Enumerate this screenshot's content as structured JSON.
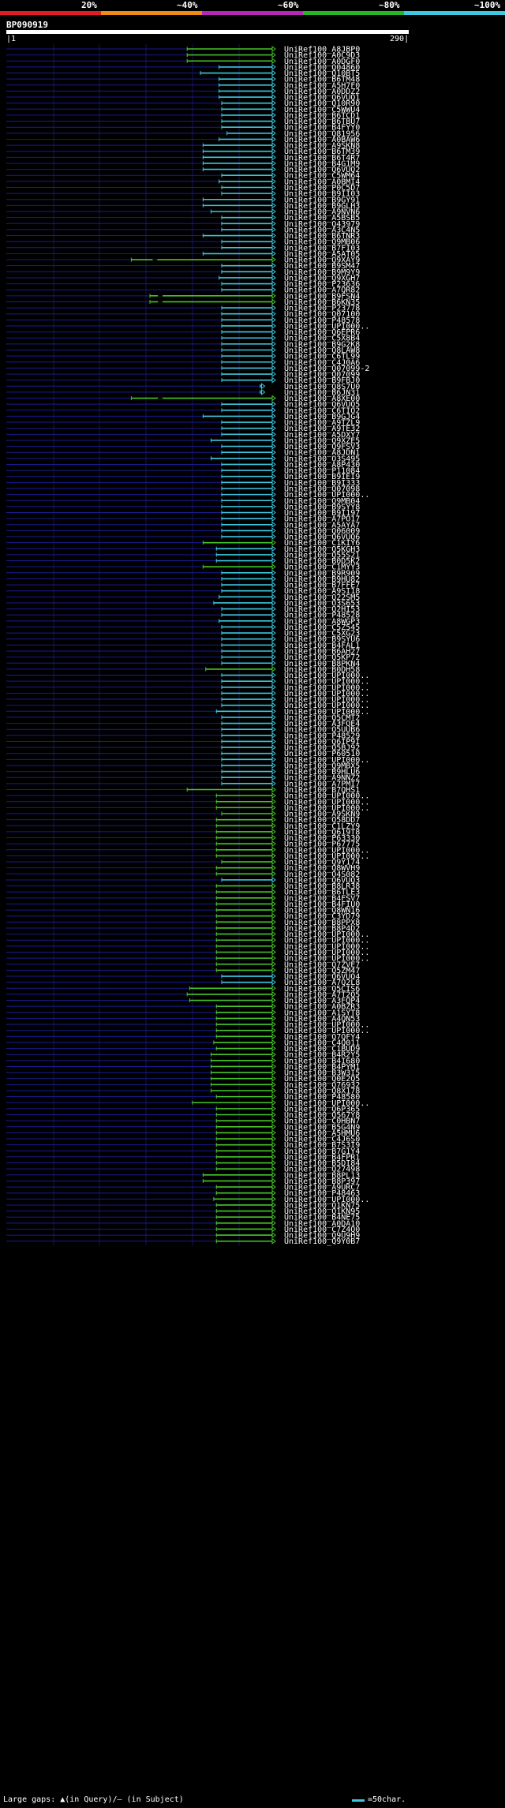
{
  "header": {
    "legend": [
      {
        "label": "20%",
        "color": "#e01c24"
      },
      {
        "label": "~40%",
        "color": "#f08c14"
      },
      {
        "label": "~60%",
        "color": "#b428b4"
      },
      {
        "label": "~80%",
        "color": "#28b428"
      },
      {
        "label": "~100%",
        "color": "#3cc8e0"
      }
    ],
    "query_name": "BP090919",
    "ruler_start": "1",
    "ruler_end": "290"
  },
  "footer": {
    "gaps_text": "Large gaps: ▲(in Query)/– (in Subject)",
    "scale_text": "=50char."
  },
  "colors": {
    "cyan": "#3cc8e0",
    "green": "#46c828",
    "blue": "#1a1a96",
    "grid": "#141450"
  },
  "hits": [
    {
      "id": "UniRef100_A8JBP0",
      "start": 0.68,
      "color": "green"
    },
    {
      "id": "UniRef100_A0C9D3",
      "start": 0.68,
      "color": "green"
    },
    {
      "id": "UniRef100_A0DGF0",
      "start": 0.68,
      "color": "green"
    },
    {
      "id": "UniRef100_Q04860",
      "start": 0.8,
      "color": "cyan"
    },
    {
      "id": "UniRef100_Q10BT5",
      "start": 0.73,
      "color": "cyan"
    },
    {
      "id": "UniRef100_B6TM48",
      "start": 0.8,
      "color": "cyan"
    },
    {
      "id": "UniRef100_A5H7F0",
      "start": 0.8,
      "color": "cyan"
    },
    {
      "id": "UniRef100_A0DDZ2",
      "start": 0.8,
      "color": "cyan"
    },
    {
      "id": "UniRef100_Q6VUQ1",
      "start": 0.8,
      "color": "cyan"
    },
    {
      "id": "UniRef100_Q10R90",
      "start": 0.81,
      "color": "cyan"
    },
    {
      "id": "UniRef100_C5WWU4",
      "start": 0.81,
      "color": "cyan"
    },
    {
      "id": "UniRef100_B6TCD1",
      "start": 0.81,
      "color": "cyan"
    },
    {
      "id": "UniRef100_B6TBU7",
      "start": 0.81,
      "color": "cyan"
    },
    {
      "id": "UniRef100_B4FYY0",
      "start": 0.81,
      "color": "cyan"
    },
    {
      "id": "UniRef100_Q81956",
      "start": 0.83,
      "color": "cyan"
    },
    {
      "id": "UniRef100_A0BAW6",
      "start": 0.8,
      "color": "cyan"
    },
    {
      "id": "UniRef100_A9SKN8",
      "start": 0.74,
      "color": "cyan"
    },
    {
      "id": "UniRef100_B6TM39",
      "start": 0.74,
      "color": "cyan"
    },
    {
      "id": "UniRef100_B6T4R7",
      "start": 0.74,
      "color": "cyan"
    },
    {
      "id": "UniRef100_B4G1M9",
      "start": 0.74,
      "color": "cyan"
    },
    {
      "id": "UniRef100_Q6VUQ2",
      "start": 0.74,
      "color": "cyan"
    },
    {
      "id": "UniRef100_C5WM64",
      "start": 0.81,
      "color": "cyan"
    },
    {
      "id": "UniRef100_A0BMI4",
      "start": 0.8,
      "color": "cyan"
    },
    {
      "id": "UniRef100_P0C5D7",
      "start": 0.81,
      "color": "cyan"
    },
    {
      "id": "UniRef100_B9II03",
      "start": 0.81,
      "color": "cyan"
    },
    {
      "id": "UniRef100_B9GY91",
      "start": 0.74,
      "color": "cyan"
    },
    {
      "id": "UniRef100_B9GLH3",
      "start": 0.74,
      "color": "cyan"
    },
    {
      "id": "UniRef100_A9NVN6",
      "start": 0.77,
      "color": "cyan"
    },
    {
      "id": "UniRef100_A5BSB5",
      "start": 0.81,
      "color": "cyan"
    },
    {
      "id": "UniRef100_Q43979",
      "start": 0.81,
      "color": "cyan"
    },
    {
      "id": "UniRef100_A3C4N5",
      "start": 0.81,
      "color": "cyan"
    },
    {
      "id": "UniRef100_B6TNR3",
      "start": 0.74,
      "color": "cyan"
    },
    {
      "id": "UniRef100_Q9MB06",
      "start": 0.81,
      "color": "cyan"
    },
    {
      "id": "UniRef100_B7FI03",
      "start": 0.81,
      "color": "cyan"
    },
    {
      "id": "UniRef100_A5AT05",
      "start": 0.74,
      "color": "cyan"
    },
    {
      "id": "UniRef100_Q9XAY9",
      "start": 0.47,
      "color": "green",
      "gap": 0.55
    },
    {
      "id": "UniRef100_B9SM47",
      "start": 0.81,
      "color": "cyan"
    },
    {
      "id": "UniRef100_B9M9Y9",
      "start": 0.81,
      "color": "cyan"
    },
    {
      "id": "UniRef100_Q9XGH7",
      "start": 0.8,
      "color": "cyan"
    },
    {
      "id": "UniRef100_P23636",
      "start": 0.81,
      "color": "cyan"
    },
    {
      "id": "UniRef100_A7QR82",
      "start": 0.81,
      "color": "cyan"
    },
    {
      "id": "UniRef100_B9FSN4",
      "start": 0.54,
      "color": "green",
      "gap": 0.57
    },
    {
      "id": "UniRef100_B6KN35",
      "start": 0.54,
      "color": "green",
      "gap": 0.57
    },
    {
      "id": "UniRef100_P23778",
      "start": 0.81,
      "color": "cyan"
    },
    {
      "id": "UniRef100_Q07100",
      "start": 0.81,
      "color": "cyan"
    },
    {
      "id": "UniRef100_P48578",
      "start": 0.81,
      "color": "cyan"
    },
    {
      "id": "UniRef100_UPI000..",
      "start": 0.81,
      "color": "cyan"
    },
    {
      "id": "UniRef100_Q6EPR6",
      "start": 0.81,
      "color": "cyan"
    },
    {
      "id": "UniRef100_C5X8B4",
      "start": 0.81,
      "color": "cyan"
    },
    {
      "id": "UniRef100_B9G2K8",
      "start": 0.81,
      "color": "cyan"
    },
    {
      "id": "UniRef100_Q8LAW8",
      "start": 0.81,
      "color": "cyan"
    },
    {
      "id": "UniRef100_C6TL99",
      "start": 0.81,
      "color": "cyan"
    },
    {
      "id": "UniRef100_C4J0A6",
      "start": 0.81,
      "color": "cyan"
    },
    {
      "id": "UniRef100_Q07099-2",
      "start": 0.81,
      "color": "cyan"
    },
    {
      "id": "UniRef100_Q07099",
      "start": 0.81,
      "color": "cyan"
    },
    {
      "id": "UniRef100_B9FBJ0",
      "start": 0.81,
      "color": "cyan"
    },
    {
      "id": "UniRef100_Q8S7U0",
      "start": 0.955,
      "color": "cyan",
      "end": 0.96
    },
    {
      "id": "UniRef100_B6JN31",
      "start": 0.955,
      "color": "cyan",
      "end": 0.96
    },
    {
      "id": "UniRef100_A8XE00",
      "start": 0.47,
      "color": "green",
      "gap": 0.57
    },
    {
      "id": "UniRef100_Q6VUQ5",
      "start": 0.81,
      "color": "cyan"
    },
    {
      "id": "UniRef100_C6TIO2",
      "start": 0.81,
      "color": "cyan"
    },
    {
      "id": "UniRef100_B9GJG4",
      "start": 0.74,
      "color": "cyan"
    },
    {
      "id": "UniRef100_A9TZL9",
      "start": 0.81,
      "color": "cyan"
    },
    {
      "id": "UniRef100_A9TE32",
      "start": 0.81,
      "color": "cyan"
    },
    {
      "id": "UniRef100_A5DXY7",
      "start": 0.81,
      "color": "cyan"
    },
    {
      "id": "UniRef100_Q9XZE5",
      "start": 0.77,
      "color": "cyan"
    },
    {
      "id": "UniRef100_Q9FSV3",
      "start": 0.81,
      "color": "cyan"
    },
    {
      "id": "UniRef100_A8JDN1",
      "start": 0.81,
      "color": "cyan"
    },
    {
      "id": "UniRef100_O3S495",
      "start": 0.77,
      "color": "cyan"
    },
    {
      "id": "UniRef100_A8P430",
      "start": 0.81,
      "color": "cyan"
    },
    {
      "id": "UniRef100_P11084",
      "start": 0.81,
      "color": "cyan"
    },
    {
      "id": "UniRef100_B9IEI9",
      "start": 0.81,
      "color": "cyan"
    },
    {
      "id": "UniRef100_B9I333",
      "start": 0.81,
      "color": "cyan"
    },
    {
      "id": "UniRef100_Q07098",
      "start": 0.81,
      "color": "cyan"
    },
    {
      "id": "UniRef100_UPI000..",
      "start": 0.81,
      "color": "cyan"
    },
    {
      "id": "UniRef100_Q9MB04",
      "start": 0.81,
      "color": "cyan"
    },
    {
      "id": "UniRef100_B9SYY8",
      "start": 0.81,
      "color": "cyan"
    },
    {
      "id": "UniRef100_B9I197",
      "start": 0.81,
      "color": "cyan"
    },
    {
      "id": "UniRef100_A7PO17",
      "start": 0.81,
      "color": "cyan"
    },
    {
      "id": "UniRef100_A5AYA7",
      "start": 0.81,
      "color": "cyan"
    },
    {
      "id": "UniRef100_Q06009",
      "start": 0.81,
      "color": "cyan"
    },
    {
      "id": "UniRef100_Q6VUQ6",
      "start": 0.81,
      "color": "cyan"
    },
    {
      "id": "UniRef100_C1KIY6",
      "start": 0.74,
      "color": "green"
    },
    {
      "id": "UniRef100_Q5KGH3",
      "start": 0.79,
      "color": "cyan"
    },
    {
      "id": "UniRef100_Q55S21",
      "start": 0.79,
      "color": "cyan"
    },
    {
      "id": "UniRef100_B0D5K2",
      "start": 0.79,
      "color": "cyan"
    },
    {
      "id": "UniRef100_C1MYY3",
      "start": 0.74,
      "color": "green"
    },
    {
      "id": "UniRef100_B9R909",
      "start": 0.81,
      "color": "cyan"
    },
    {
      "id": "UniRef100_B9HU82",
      "start": 0.81,
      "color": "cyan"
    },
    {
      "id": "UniRef100_B7FFE7",
      "start": 0.81,
      "color": "cyan"
    },
    {
      "id": "UniRef100_A9SI18",
      "start": 0.81,
      "color": "cyan"
    },
    {
      "id": "UniRef100_Q22SM5",
      "start": 0.8,
      "color": "cyan"
    },
    {
      "id": "UniRef100_O3S653",
      "start": 0.78,
      "color": "cyan"
    },
    {
      "id": "UniRef100_Q2HI53",
      "start": 0.81,
      "color": "cyan"
    },
    {
      "id": "UniRef100_P48528",
      "start": 0.81,
      "color": "cyan"
    },
    {
      "id": "UniRef100_A8WGP3",
      "start": 0.8,
      "color": "cyan"
    },
    {
      "id": "UniRef100_C5Z545",
      "start": 0.81,
      "color": "cyan"
    },
    {
      "id": "UniRef100_C5XG23",
      "start": 0.81,
      "color": "cyan"
    },
    {
      "id": "UniRef100_B9SYU6",
      "start": 0.81,
      "color": "cyan"
    },
    {
      "id": "UniRef100_B4FAL1",
      "start": 0.81,
      "color": "cyan"
    },
    {
      "id": "UniRef100_B6AH27",
      "start": 0.81,
      "color": "cyan"
    },
    {
      "id": "UniRef100_Q5KP72",
      "start": 0.81,
      "color": "cyan"
    },
    {
      "id": "UniRef100_B8PKN4",
      "start": 0.81,
      "color": "cyan"
    },
    {
      "id": "UniRef100_B0DH58",
      "start": 0.75,
      "color": "green"
    },
    {
      "id": "UniRef100_UPI000..",
      "start": 0.81,
      "color": "cyan"
    },
    {
      "id": "UniRef100_UPI000..",
      "start": 0.81,
      "color": "cyan"
    },
    {
      "id": "UniRef100_UPI000..",
      "start": 0.81,
      "color": "cyan"
    },
    {
      "id": "UniRef100_UPI000..",
      "start": 0.81,
      "color": "cyan"
    },
    {
      "id": "UniRef100_UPI000..",
      "start": 0.81,
      "color": "cyan"
    },
    {
      "id": "UniRef100_UPI000..",
      "start": 0.81,
      "color": "cyan"
    },
    {
      "id": "UniRef100_UPI000..",
      "start": 0.79,
      "color": "cyan"
    },
    {
      "id": "UniRef100_Q5CMT2",
      "start": 0.81,
      "color": "cyan"
    },
    {
      "id": "UniRef100_A3FQE4",
      "start": 0.81,
      "color": "cyan"
    },
    {
      "id": "UniRef100_Q5UUB6",
      "start": 0.81,
      "color": "cyan"
    },
    {
      "id": "UniRef100_P48529",
      "start": 0.81,
      "color": "cyan"
    },
    {
      "id": "UniRef100_Q6IP9I",
      "start": 0.81,
      "color": "cyan"
    },
    {
      "id": "UniRef100_Q5BJ92",
      "start": 0.81,
      "color": "cyan"
    },
    {
      "id": "UniRef100_P60510",
      "start": 0.81,
      "color": "cyan"
    },
    {
      "id": "UniRef100_UPI000..",
      "start": 0.81,
      "color": "cyan"
    },
    {
      "id": "UniRef100_Q9MBX5",
      "start": 0.81,
      "color": "cyan"
    },
    {
      "id": "UniRef100_B9HLU6",
      "start": 0.81,
      "color": "cyan"
    },
    {
      "id": "UniRef100_A9NNZ2",
      "start": 0.81,
      "color": "cyan"
    },
    {
      "id": "UniRef100_A7PMI7",
      "start": 0.81,
      "color": "cyan"
    },
    {
      "id": "UniRef100_B7QHS1",
      "start": 0.68,
      "color": "green"
    },
    {
      "id": "UniRef100_UPI000..",
      "start": 0.79,
      "color": "green"
    },
    {
      "id": "UniRef100_UPI000..",
      "start": 0.79,
      "color": "green"
    },
    {
      "id": "UniRef100_UPI000..",
      "start": 0.79,
      "color": "green"
    },
    {
      "id": "UniRef100_A9SKN9",
      "start": 0.81,
      "color": "green"
    },
    {
      "id": "UniRef100_Q58DD7",
      "start": 0.79,
      "color": "green"
    },
    {
      "id": "UniRef100_C1LZY9",
      "start": 0.79,
      "color": "green"
    },
    {
      "id": "UniRef100_Q619T8",
      "start": 0.79,
      "color": "green"
    },
    {
      "id": "UniRef100_P63330",
      "start": 0.79,
      "color": "green"
    },
    {
      "id": "UniRef100_P67775",
      "start": 0.79,
      "color": "green"
    },
    {
      "id": "UniRef100_UPI000..",
      "start": 0.79,
      "color": "green"
    },
    {
      "id": "UniRef100_UPI000..",
      "start": 0.79,
      "color": "green"
    },
    {
      "id": "UniRef100_Q9Y174",
      "start": 0.81,
      "color": "green"
    },
    {
      "id": "UniRef100_Q8WVH9",
      "start": 0.79,
      "color": "green"
    },
    {
      "id": "UniRef100_O4S082",
      "start": 0.79,
      "color": "green"
    },
    {
      "id": "UniRef100_Q6VUQ3",
      "start": 0.81,
      "color": "cyan"
    },
    {
      "id": "UniRef100_B8LR38",
      "start": 0.79,
      "color": "green"
    },
    {
      "id": "UniRef100_B6TLE3",
      "start": 0.79,
      "color": "green"
    },
    {
      "id": "UniRef100_B4FSV7",
      "start": 0.79,
      "color": "green"
    },
    {
      "id": "UniRef100_B4FIU0",
      "start": 0.79,
      "color": "green"
    },
    {
      "id": "UniRef100_Q8WN16",
      "start": 0.79,
      "color": "green"
    },
    {
      "id": "UniRef100_C3YD79",
      "start": 0.79,
      "color": "green"
    },
    {
      "id": "UniRef100_B8PPX8",
      "start": 0.79,
      "color": "green"
    },
    {
      "id": "UniRef100_B8P4D2",
      "start": 0.79,
      "color": "green"
    },
    {
      "id": "UniRef100_UPI000..",
      "start": 0.79,
      "color": "green"
    },
    {
      "id": "UniRef100_UPI000..",
      "start": 0.79,
      "color": "green"
    },
    {
      "id": "UniRef100_UPI000..",
      "start": 0.79,
      "color": "green"
    },
    {
      "id": "UniRef100_UPI000..",
      "start": 0.79,
      "color": "green"
    },
    {
      "id": "UniRef100_UPI000..",
      "start": 0.79,
      "color": "green"
    },
    {
      "id": "UniRef100_Q7ZVE7",
      "start": 0.79,
      "color": "green"
    },
    {
      "id": "UniRef100_Q5ZM47",
      "start": 0.79,
      "color": "green"
    },
    {
      "id": "UniRef100_Q6VUQ4",
      "start": 0.81,
      "color": "cyan"
    },
    {
      "id": "UniRef100_A7Q2L8",
      "start": 0.81,
      "color": "cyan"
    },
    {
      "id": "UniRef100_Q5CIS6",
      "start": 0.69,
      "color": "green"
    },
    {
      "id": "UniRef100_A7T2Q5",
      "start": 0.68,
      "color": "green"
    },
    {
      "id": "UniRef100_A3FQP4",
      "start": 0.69,
      "color": "green"
    },
    {
      "id": "UniRef100_A0BZR3",
      "start": 0.79,
      "color": "green"
    },
    {
      "id": "UniRef100_A1SYT8",
      "start": 0.79,
      "color": "green"
    },
    {
      "id": "UniRef100_A4QN53",
      "start": 0.79,
      "color": "green"
    },
    {
      "id": "UniRef100_UPI000..",
      "start": 0.79,
      "color": "green"
    },
    {
      "id": "UniRef100_UPI000..",
      "start": 0.79,
      "color": "green"
    },
    {
      "id": "UniRef100_Q7QFY4",
      "start": 0.79,
      "color": "green"
    },
    {
      "id": "UniRef100_C4Q011",
      "start": 0.78,
      "color": "green"
    },
    {
      "id": "UniRef100_C1BUD9",
      "start": 0.79,
      "color": "green"
    },
    {
      "id": "UniRef100_B4R2Y5",
      "start": 0.77,
      "color": "green"
    },
    {
      "id": "UniRef100_B4I680",
      "start": 0.77,
      "color": "green"
    },
    {
      "id": "UniRef100_B4PYM1",
      "start": 0.77,
      "color": "green"
    },
    {
      "id": "UniRef100_B3W3I5",
      "start": 0.77,
      "color": "green"
    },
    {
      "id": "UniRef100_Q0E2Q5",
      "start": 0.77,
      "color": "green"
    },
    {
      "id": "UniRef100_Q76932",
      "start": 0.77,
      "color": "green"
    },
    {
      "id": "UniRef100_Q8X178",
      "start": 0.77,
      "color": "green"
    },
    {
      "id": "UniRef100_P48580",
      "start": 0.79,
      "color": "green"
    },
    {
      "id": "UniRef100_UPI000..",
      "start": 0.7,
      "color": "green"
    },
    {
      "id": "UniRef100_Q6P365",
      "start": 0.79,
      "color": "green"
    },
    {
      "id": "UniRef100_Q567Y8",
      "start": 0.79,
      "color": "green"
    },
    {
      "id": "UniRef100_C0HBN7",
      "start": 0.79,
      "color": "green"
    },
    {
      "id": "UniRef100_B5G4N9",
      "start": 0.79,
      "color": "green"
    },
    {
      "id": "UniRef100_A5HMU6",
      "start": 0.79,
      "color": "green"
    },
    {
      "id": "UniRef100_C4J6S0",
      "start": 0.79,
      "color": "green"
    },
    {
      "id": "UniRef100_B7S3I9",
      "start": 0.79,
      "color": "green"
    },
    {
      "id": "UniRef100_B7G1Y4",
      "start": 0.79,
      "color": "green"
    },
    {
      "id": "UniRef100_B4FPR1",
      "start": 0.79,
      "color": "green"
    },
    {
      "id": "UniRef100_B5DI84",
      "start": 0.79,
      "color": "green"
    },
    {
      "id": "UniRef100_Q27498",
      "start": 0.79,
      "color": "green"
    },
    {
      "id": "UniRef100_B8PL13",
      "start": 0.74,
      "color": "green"
    },
    {
      "id": "UniRef100_B8P397",
      "start": 0.74,
      "color": "green"
    },
    {
      "id": "UniRef100_A9URC7",
      "start": 0.79,
      "color": "green"
    },
    {
      "id": "UniRef100_P48463",
      "start": 0.79,
      "color": "green"
    },
    {
      "id": "UniRef100_UPI000..",
      "start": 0.78,
      "color": "green"
    },
    {
      "id": "UniRef100_Q1KN75",
      "start": 0.79,
      "color": "green"
    },
    {
      "id": "UniRef100_Q1KN95",
      "start": 0.79,
      "color": "green"
    },
    {
      "id": "UniRef100_B4NE75",
      "start": 0.79,
      "color": "green"
    },
    {
      "id": "UniRef100_A0DA10",
      "start": 0.79,
      "color": "green"
    },
    {
      "id": "UniRef100_C7Z4Q0",
      "start": 0.79,
      "color": "green"
    },
    {
      "id": "UniRef100_Q9U9H9",
      "start": 0.79,
      "color": "green"
    },
    {
      "id": "UniRef100_Q9Y0B7",
      "start": 0.79,
      "color": "green"
    }
  ]
}
